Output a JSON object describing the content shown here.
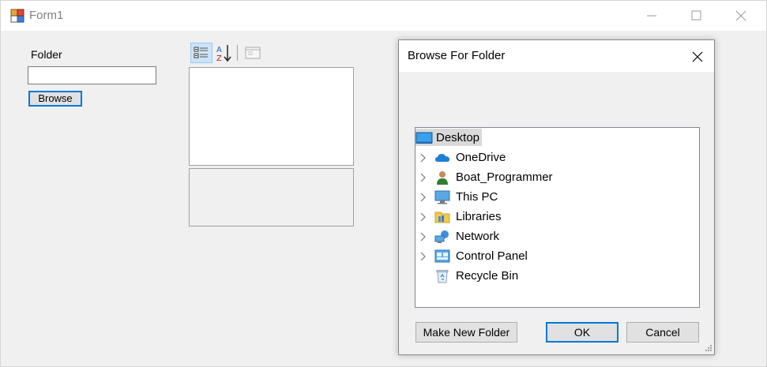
{
  "window": {
    "title": "Form1"
  },
  "form": {
    "folder_label": "Folder",
    "folder_value": "",
    "browse_label": "Browse"
  },
  "dialog": {
    "title": "Browse For Folder",
    "tree": [
      {
        "label": "Desktop",
        "icon": "desktop-icon",
        "expandable": false,
        "selected": true
      },
      {
        "label": "OneDrive",
        "icon": "cloud-icon",
        "expandable": true
      },
      {
        "label": "Boat_Programmer",
        "icon": "user-icon",
        "expandable": true
      },
      {
        "label": "This PC",
        "icon": "computer-icon",
        "expandable": true
      },
      {
        "label": "Libraries",
        "icon": "libraries-folder-icon",
        "expandable": true
      },
      {
        "label": "Network",
        "icon": "network-icon",
        "expandable": true
      },
      {
        "label": "Control Panel",
        "icon": "control-panel-icon",
        "expandable": true
      },
      {
        "label": "Recycle Bin",
        "icon": "recycle-bin-icon",
        "expandable": false
      }
    ],
    "buttons": {
      "new_folder": "Make New Folder",
      "ok": "OK",
      "cancel": "Cancel"
    }
  },
  "colors": {
    "accent": "#0078d7",
    "selection": "#d9d9d9",
    "window_bg": "#f0f0f0"
  }
}
